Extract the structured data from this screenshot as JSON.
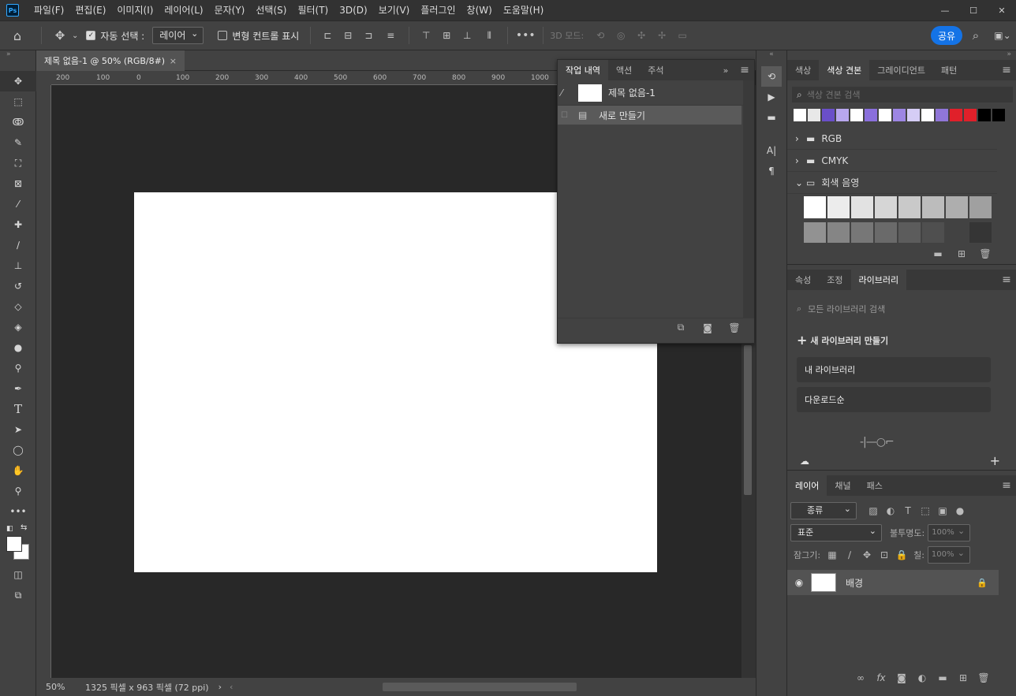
{
  "app": {
    "logo": "Ps"
  },
  "menu": [
    "파일(F)",
    "편집(E)",
    "이미지(I)",
    "레이어(L)",
    "문자(Y)",
    "선택(S)",
    "필터(T)",
    "3D(D)",
    "보기(V)",
    "플러그인",
    "창(W)",
    "도움말(H)"
  ],
  "options": {
    "auto_select_label": "자동 선택 :",
    "auto_select_value": "레이어",
    "transform_label": "변형 컨트롤 표시",
    "mode_3d_label": "3D 모드:",
    "share_label": "공유"
  },
  "document": {
    "tab_title": "제목 없음-1 @ 50% (RGB/8#)",
    "zoom": "50%",
    "info": "1325 픽셀 x 963 픽셀 (72 ppi)"
  },
  "ruler_h": [
    "200",
    "100",
    "0",
    "100",
    "200",
    "300",
    "400",
    "500",
    "600",
    "700",
    "800",
    "900",
    "1000"
  ],
  "history_panel": {
    "tabs": [
      "작업 내역",
      "액션",
      "주석"
    ],
    "snapshot_label": "제목 없음-1",
    "items": [
      "새로 만들기"
    ]
  },
  "swatches_panel": {
    "tabs": [
      "색상",
      "색상 견본",
      "그레이디언트",
      "패턴"
    ],
    "search_placeholder": "색상 견본 검색",
    "recent_colors": [
      "#ffffff",
      "#e8e8e8",
      "#6a4fc9",
      "#b8a7ee",
      "#ffffff",
      "#8a6fdc",
      "#ffffff",
      "#9d86e3",
      "#d5cdf5",
      "#ffffff",
      "#9076d8",
      "#e0202a",
      "#e0202a",
      "#000000",
      "#000000"
    ],
    "folders": [
      "RGB",
      "CMYK",
      "회색 음영"
    ],
    "grays": [
      "#ffffff",
      "#ececec",
      "#e2e2e2",
      "#d6d6d6",
      "#c9c9c9",
      "#bcbcbc",
      "#aeaeae",
      "#a0a0a0",
      "#929292",
      "#858585",
      "#777777",
      "#6a6a6a",
      "#5c5c5c",
      "#4f4f4f",
      "#424242",
      "#353535"
    ]
  },
  "library_panel": {
    "tabs": [
      "속성",
      "조정",
      "라이브러리"
    ],
    "search_placeholder": "모든 라이브러리 검색",
    "new_library_label": "새 라이브러리 만들기",
    "items": [
      "내 라이브러리",
      "다운로드순"
    ]
  },
  "layers_panel": {
    "tabs": [
      "레이어",
      "채널",
      "패스"
    ],
    "filter_label": "종류",
    "blend_mode": "표준",
    "opacity_label": "불투명도:",
    "opacity_value": "100%",
    "lock_label": "잠그기:",
    "fill_label": "칠:",
    "fill_value": "100%",
    "layers": [
      {
        "name": "배경"
      }
    ]
  },
  "colors": {
    "accent": "#1473e6",
    "canvas": "#ffffff",
    "workspace": "#282828"
  }
}
